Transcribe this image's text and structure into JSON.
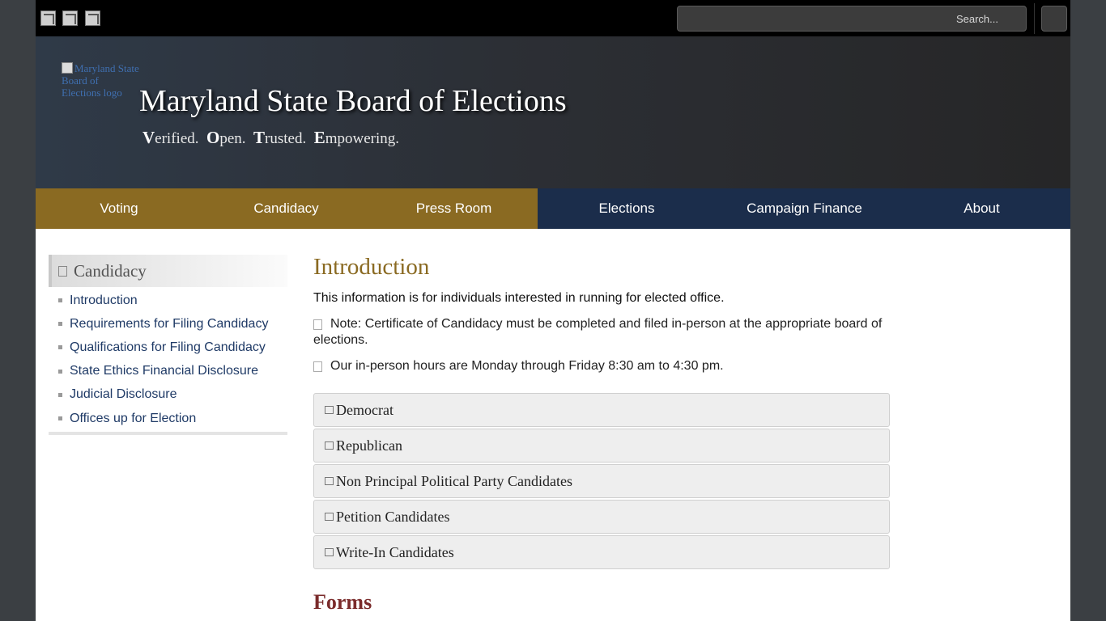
{
  "topbar": {
    "icons": [
      "image-icon",
      "image-icon",
      "image-icon"
    ],
    "search_placeholder": "Search..."
  },
  "banner": {
    "logo_alt": "Maryland State Board of Elections logo",
    "title": "Maryland State Board of Elections",
    "tagline": [
      {
        "initial": "V",
        "rest": "erified."
      },
      {
        "initial": "O",
        "rest": "pen."
      },
      {
        "initial": "T",
        "rest": "rusted."
      },
      {
        "initial": "E",
        "rest": "mpowering."
      }
    ]
  },
  "nav": {
    "items": [
      "Voting",
      "Candidacy",
      "Press Room",
      "Elections",
      "Campaign Finance",
      "About"
    ]
  },
  "sidebar": {
    "heading": "Candidacy",
    "items": [
      "Introduction",
      "Requirements for Filing Candidacy",
      "Qualifications for Filing Candidacy",
      "State Ethics Financial Disclosure",
      "Judicial Disclosure",
      "Offices up for Election"
    ]
  },
  "main": {
    "heading": "Introduction",
    "intro": "This information is for individuals interested in running for elected office.",
    "note1": "Note: Certificate of Candidacy must be completed and filed in-person at the appropriate board of elections.",
    "note2": "Our in-person hours are Monday through Friday 8:30 am to 4:30 pm.",
    "accordions": [
      "Democrat",
      "Republican",
      "Non Principal Political Party Candidates",
      "Petition Candidates",
      "Write-In Candidates"
    ],
    "forms_heading": "Forms"
  },
  "colors": {
    "nav_gold": "#8a6a22",
    "nav_navy": "#1b2d4b",
    "heading_gold": "#8a6a22",
    "forms_heading": "#7a2b2b",
    "link": "#1f3a66"
  }
}
